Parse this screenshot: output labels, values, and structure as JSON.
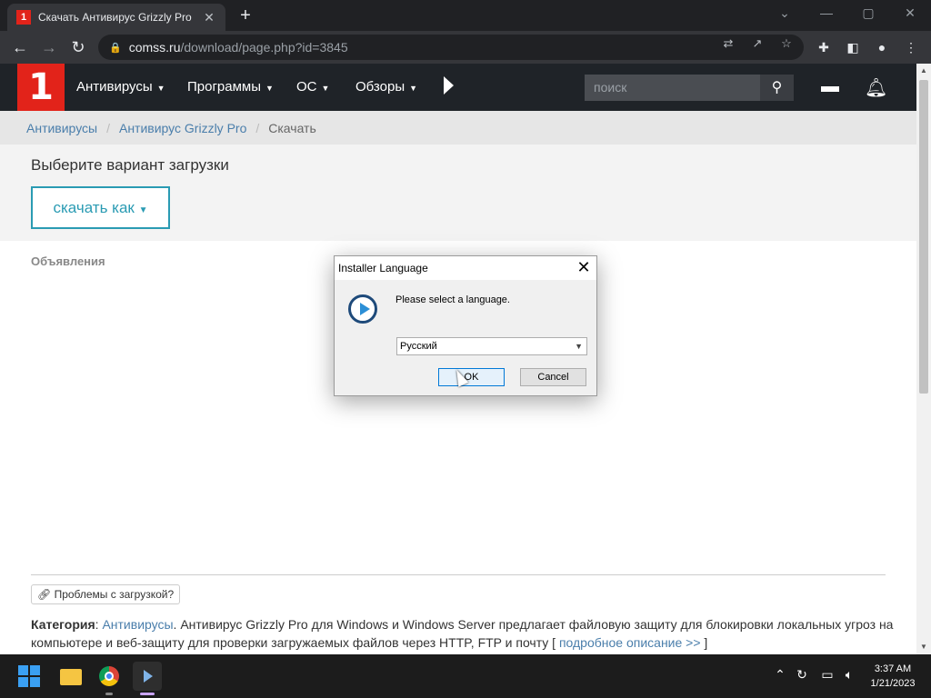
{
  "browser": {
    "tab_title": "Скачать Антивирус Grizzly Pro",
    "tab_favicon": "1",
    "tab_close": "✕",
    "new_tab": "+",
    "url_host": "comss.ru",
    "url_path": "/download/page.php?id=3845",
    "window_controls": {
      "minimize": "—",
      "maximize": "▢",
      "close": "✕",
      "dropdown": "⌄"
    }
  },
  "site": {
    "logo": "1",
    "nav": [
      {
        "label": "Антивирусы"
      },
      {
        "label": "Программы"
      },
      {
        "label": "ОС"
      },
      {
        "label": "Обзоры"
      }
    ],
    "search_placeholder": "поиск",
    "breadcrumb": [
      {
        "label": "Антивирусы"
      },
      {
        "label": "Антивирус Grizzly Pro"
      }
    ],
    "breadcrumb_current": "Скачать",
    "download_title": "Выберите вариант загрузки",
    "download_button": "скачать как",
    "ads_label": "Объявления",
    "problem_button": "Проблемы с загрузкой?",
    "category_label": "Категория",
    "category_link": "Антивирусы",
    "description": ". Антивирус Grizzly Pro для Windows и Windows Server предлагает файловую защиту для блокировки локальных угроз на компьютере и веб-защиту для проверки загружаемых файлов через HTTP, FTP и почту [",
    "more_link": "подробное описание >>",
    "description_end": "]"
  },
  "dialog": {
    "title": "Installer Language",
    "message": "Please select a language.",
    "selected_language": "Русский",
    "ok_label": "OK",
    "cancel_label": "Cancel"
  },
  "taskbar": {
    "time": "3:37 AM",
    "date": "1/21/2023"
  },
  "colors": {
    "brand_red": "#e2231a",
    "header_bg": "#1f2328",
    "link_blue": "#4a7eab",
    "download_teal": "#2a9bb3"
  }
}
